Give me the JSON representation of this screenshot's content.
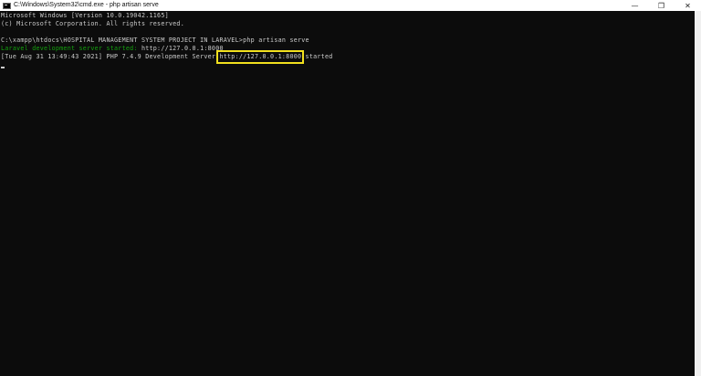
{
  "window": {
    "title": "C:\\Windows\\System32\\cmd.exe - php  artisan serve",
    "icon": "cmd-icon",
    "controls": {
      "minimize": "—",
      "maximize": "❐",
      "close": "✕"
    }
  },
  "console": {
    "lines": [
      "Microsoft Windows [Version 10.0.19042.1165]",
      "(c) Microsoft Corporation. All rights reserved.",
      "",
      "C:\\xampp\\htdocs\\HOSPITAL MANAGEMENT SYSTEM PROJECT IN LARAVEL>php artisan serve"
    ],
    "server_line": {
      "label": "Laravel development server started:",
      "url": " http://127.0.0.1:8000"
    },
    "status_line": {
      "prefix": "[Tue Aug 31 13:49:43 2021] PHP 7.4.9 Development Server ",
      "url": "http://127.0.0.1:8000",
      "suffix": " started"
    }
  },
  "colors": {
    "background": "#0c0c0c",
    "text": "#cccccc",
    "green": "#13a10e",
    "highlight": "#f2e01e"
  }
}
